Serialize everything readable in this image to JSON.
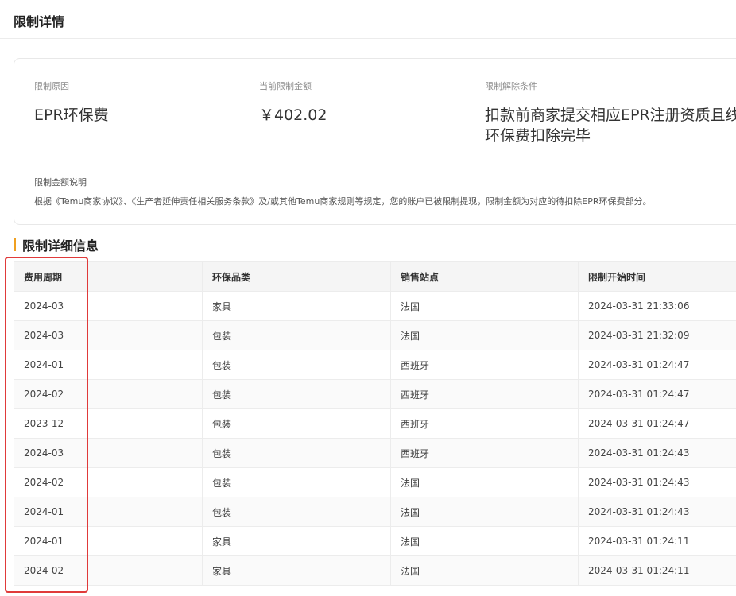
{
  "header": {
    "title": "限制详情"
  },
  "info": {
    "reason_label": "限制原因",
    "reason_value": "EPR环保费",
    "amount_label": "当前限制金额",
    "amount_value": "￥402.02",
    "condition_label": "限制解除条件",
    "condition_line1": "扣款前商家提交相应EPR注册资质且线",
    "condition_line2": "环保费扣除完毕",
    "note_label": "限制金额说明",
    "note_text": "根据《Temu商家协议》、《生产者延伸责任相关服务条款》及/或其他Temu商家规则等规定，您的账户已被限制提现，限制金额为对应的待扣除EPR环保费部分。"
  },
  "section": {
    "title": "限制详细信息",
    "accent_color": "#f0a020"
  },
  "table": {
    "headers": [
      "费用周期",
      "环保品类",
      "销售站点",
      "限制开始时间"
    ],
    "rows": [
      [
        "2024-03",
        "家具",
        "法国",
        "2024-03-31 21:33:06"
      ],
      [
        "2024-03",
        "包装",
        "法国",
        "2024-03-31 21:32:09"
      ],
      [
        "2024-01",
        "包装",
        "西班牙",
        "2024-03-31 01:24:47"
      ],
      [
        "2024-02",
        "包装",
        "西班牙",
        "2024-03-31 01:24:47"
      ],
      [
        "2023-12",
        "包装",
        "西班牙",
        "2024-03-31 01:24:47"
      ],
      [
        "2024-03",
        "包装",
        "西班牙",
        "2024-03-31 01:24:43"
      ],
      [
        "2024-02",
        "包装",
        "法国",
        "2024-03-31 01:24:43"
      ],
      [
        "2024-01",
        "包装",
        "法国",
        "2024-03-31 01:24:43"
      ],
      [
        "2024-01",
        "家具",
        "法国",
        "2024-03-31 01:24:11"
      ],
      [
        "2024-02",
        "家具",
        "法国",
        "2024-03-31 01:24:11"
      ]
    ]
  },
  "colors": {
    "highlight": "#e03a3a"
  }
}
